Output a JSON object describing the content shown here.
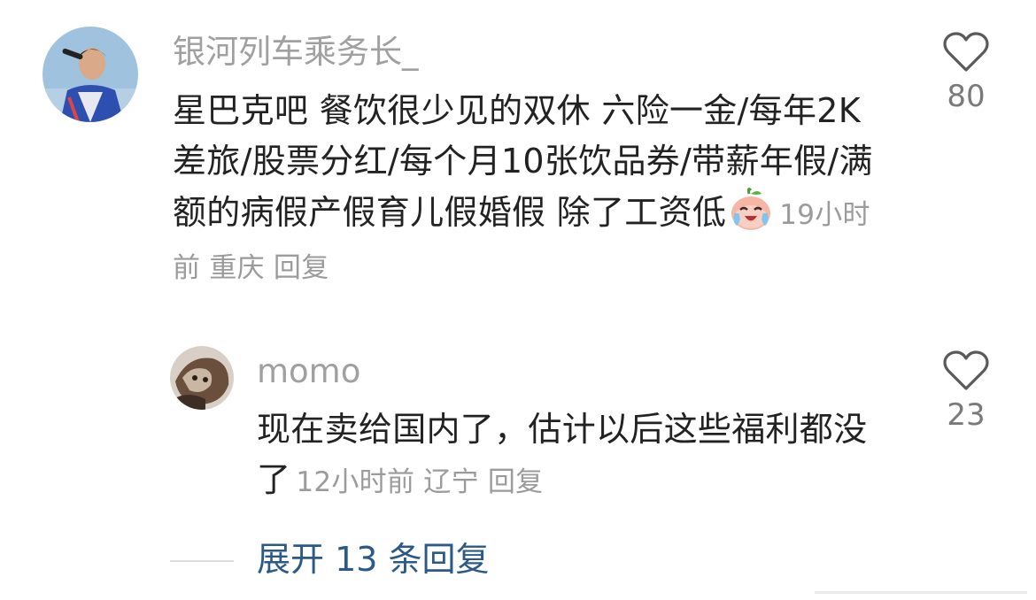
{
  "comment": {
    "username": "银河列车乘务长_",
    "text": "星巴克吧 餐饮很少见的双休 六险一金/每年2K差旅/股票分红/每个月10张饮品券/带薪年假/满额的病假产假育儿假婚假 除了工资低",
    "emoji": "crying-laughing-peach-emoji",
    "time": "19小时前",
    "location": "重庆",
    "reply_label": "回复",
    "like_count": "80"
  },
  "reply": {
    "username": "momo",
    "text": "现在卖给国内了，估计以后这些福利都没了",
    "time": "12小时前",
    "location": "辽宁",
    "reply_label": "回复",
    "like_count": "23"
  },
  "expand_replies": "展开 13 条回复",
  "colors": {
    "username": "#a0a0a0",
    "meta": "#9b9b9b",
    "expand_link": "#2b5a88"
  }
}
